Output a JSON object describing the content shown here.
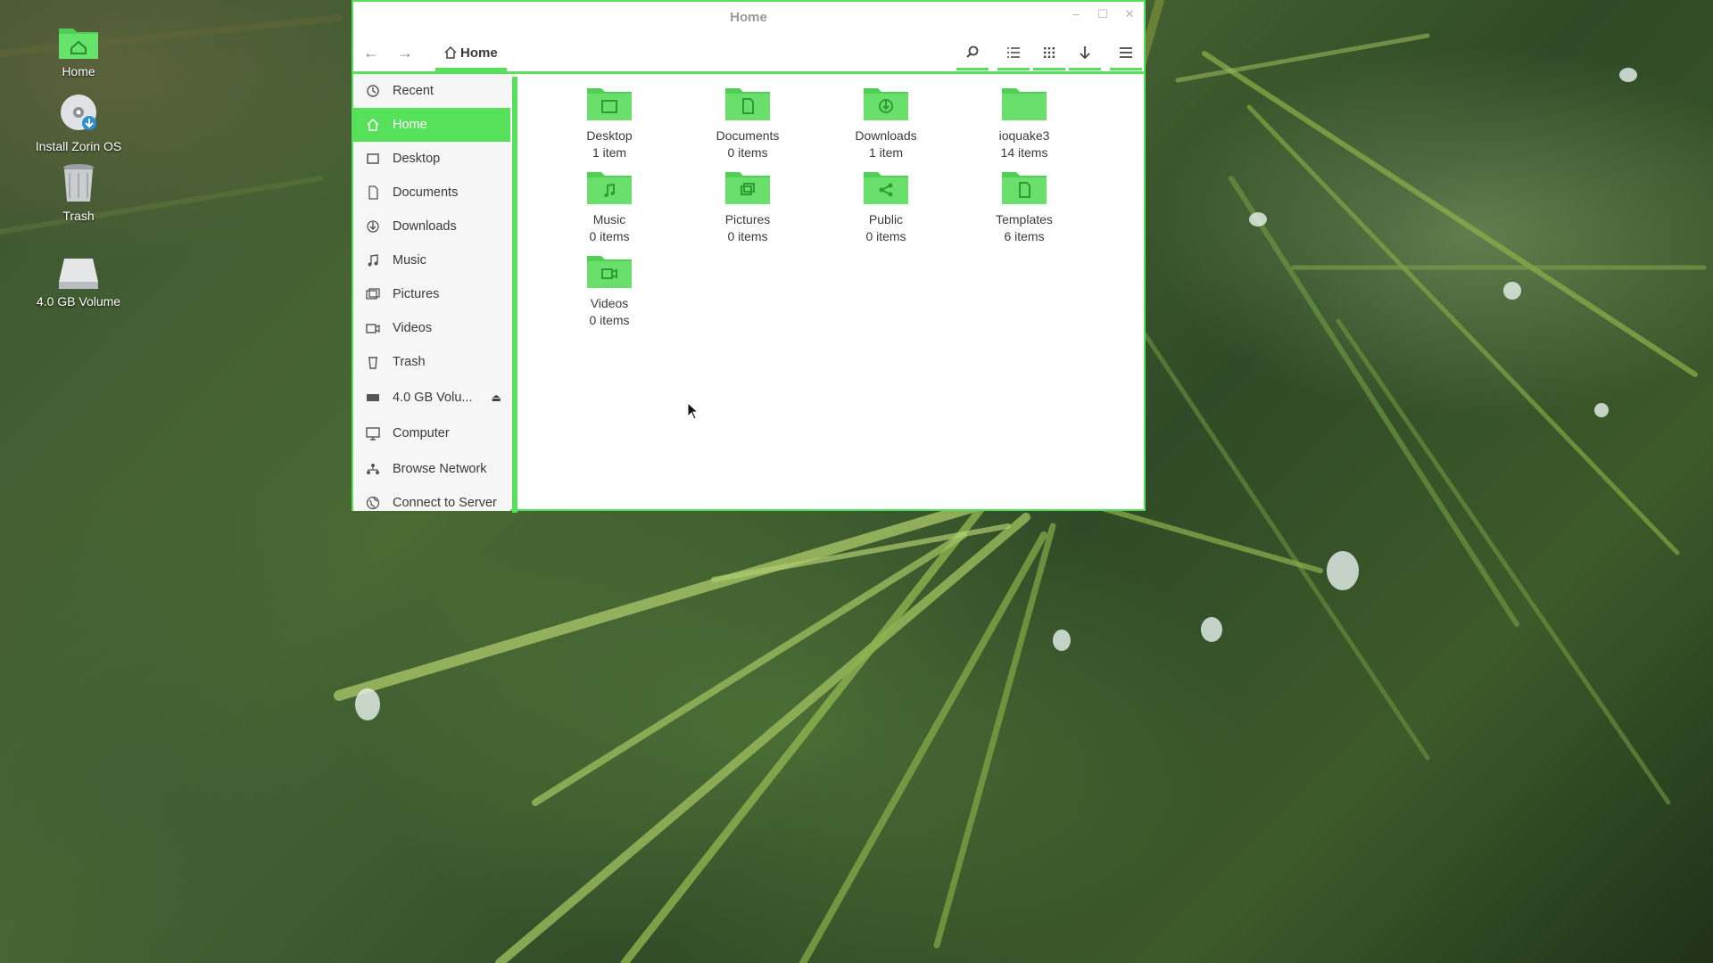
{
  "desktop": {
    "icons": [
      {
        "label": "Home",
        "icon": "home-folder-icon"
      },
      {
        "label": "Install Zorin OS",
        "icon": "install-disc-icon"
      },
      {
        "label": "Trash",
        "icon": "trash-icon"
      },
      {
        "label": "4.0 GB Volume",
        "icon": "drive-icon"
      }
    ]
  },
  "window": {
    "title": "Home",
    "controls": {
      "minimize": "–",
      "maximize": "☐",
      "close": "✕"
    },
    "accent_color": "#57e05a"
  },
  "toolbar": {
    "back_glyph": "←",
    "forward_glyph": "→",
    "breadcrumb_label": "Home",
    "search_icon": "search-icon",
    "list_view_icon": "list-view-icon",
    "grid_view_icon": "grid-view-icon",
    "download_icon": "download-arrow-icon",
    "menu_icon": "hamburger-menu-icon"
  },
  "sidebar": {
    "items": [
      {
        "label": "Recent",
        "icon": "clock-icon"
      },
      {
        "label": "Home",
        "icon": "home-icon",
        "active": true
      },
      {
        "label": "Desktop",
        "icon": "desktop-icon"
      },
      {
        "label": "Documents",
        "icon": "document-icon"
      },
      {
        "label": "Downloads",
        "icon": "download-icon"
      },
      {
        "label": "Music",
        "icon": "music-note-icon"
      },
      {
        "label": "Pictures",
        "icon": "pictures-icon"
      },
      {
        "label": "Videos",
        "icon": "video-icon"
      },
      {
        "label": "Trash",
        "icon": "trash-icon"
      },
      {
        "label": "4.0 GB Volu...",
        "icon": "drive-icon",
        "eject": "⏏"
      },
      {
        "label": "Computer",
        "icon": "computer-icon"
      },
      {
        "label": "Browse Network",
        "icon": "network-icon"
      },
      {
        "label": "Connect to Server",
        "icon": "globe-icon"
      }
    ]
  },
  "files": [
    {
      "name": "Desktop",
      "count": "1 item",
      "emblem": "desktop-emblem-icon"
    },
    {
      "name": "Documents",
      "count": "0 items",
      "emblem": "document-emblem-icon"
    },
    {
      "name": "Downloads",
      "count": "1 item",
      "emblem": "download-emblem-icon"
    },
    {
      "name": "ioquake3",
      "count": "14 items",
      "emblem": "plain-folder-icon"
    },
    {
      "name": "Music",
      "count": "0 items",
      "emblem": "music-emblem-icon"
    },
    {
      "name": "Pictures",
      "count": "0 items",
      "emblem": "pictures-emblem-icon"
    },
    {
      "name": "Public",
      "count": "0 items",
      "emblem": "share-emblem-icon"
    },
    {
      "name": "Templates",
      "count": "6 items",
      "emblem": "template-emblem-icon"
    },
    {
      "name": "Videos",
      "count": "0 items",
      "emblem": "video-emblem-icon"
    }
  ]
}
